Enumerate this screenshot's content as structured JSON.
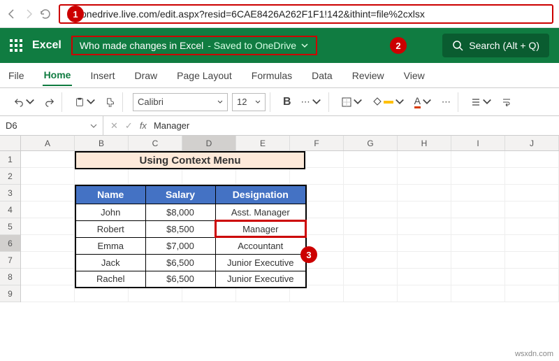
{
  "browser": {
    "url": "onedrive.live.com/edit.aspx?resid=6CAE8426A262F1F1!142&ithint=file%2cxlsx"
  },
  "header": {
    "brand": "Excel",
    "doc_title": "Who made changes in Excel",
    "saved_suffix": "- Saved to OneDrive",
    "search_label": "Search (Alt + Q)"
  },
  "tabs": [
    "File",
    "Home",
    "Insert",
    "Draw",
    "Page Layout",
    "Formulas",
    "Data",
    "Review",
    "View"
  ],
  "active_tab": "Home",
  "toolbar": {
    "font_name": "Calibri",
    "font_size": "12",
    "bold": "B"
  },
  "formula_bar": {
    "cell_ref": "D6",
    "fx_label": "fx",
    "value": "Manager"
  },
  "columns": [
    "A",
    "B",
    "C",
    "D",
    "E",
    "F",
    "G",
    "H",
    "I",
    "J"
  ],
  "rows": [
    "1",
    "2",
    "3",
    "4",
    "5",
    "6",
    "7",
    "8",
    "9"
  ],
  "selected_col": "D",
  "selected_row": "6",
  "title_cell": "Using Context Menu",
  "chart_data": {
    "type": "table",
    "headers": [
      "Name",
      "Salary",
      "Designation"
    ],
    "rows": [
      [
        "John",
        "$8,000",
        "Asst. Manager"
      ],
      [
        "Robert",
        "$8,500",
        "Manager"
      ],
      [
        "Emma",
        "$7,000",
        "Accountant"
      ],
      [
        "Jack",
        "$6,500",
        "Junior Executive"
      ],
      [
        "Rachel",
        "$6,500",
        "Junior Executive"
      ]
    ],
    "selected_cell": {
      "row": 1,
      "col": 2
    }
  },
  "callouts": {
    "c1": "1",
    "c2": "2",
    "c3": "3"
  },
  "watermark": "wsxdn.com"
}
